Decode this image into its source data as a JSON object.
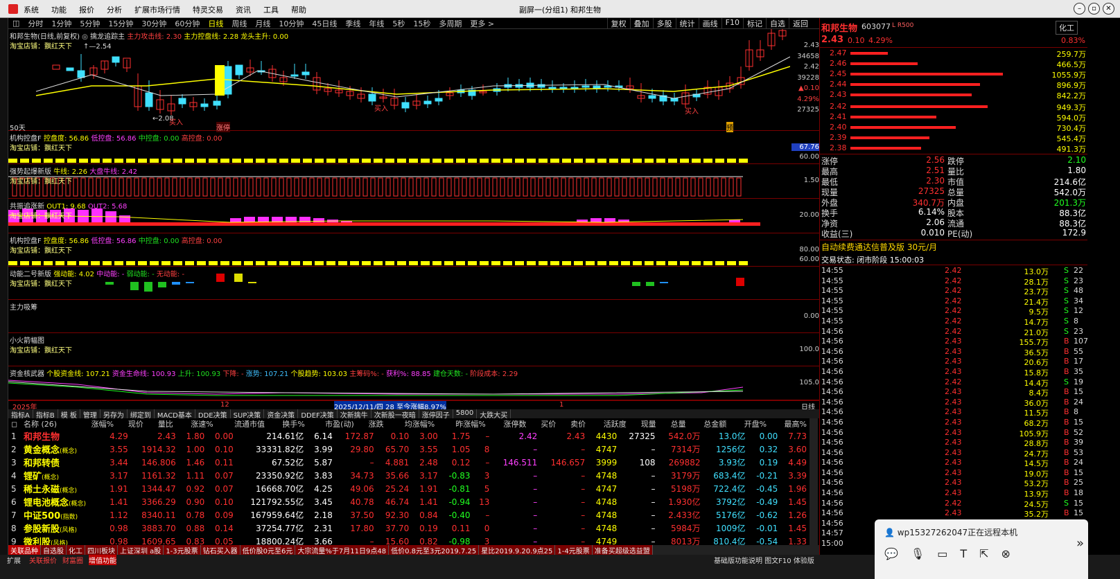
{
  "window": {
    "title": "副屏一(分组1) 和邦生物",
    "menu": [
      "系统",
      "功能",
      "报价",
      "分析",
      "扩展市场行情",
      "特灵交易",
      "资讯",
      "工具",
      "帮助"
    ]
  },
  "toolbar": {
    "periods": [
      "分时",
      "1分钟",
      "5分钟",
      "15分钟",
      "30分钟",
      "60分钟",
      "日线",
      "周线",
      "月线",
      "10分钟",
      "45日线",
      "季线",
      "年线",
      "5秒",
      "15秒",
      "多周期",
      "更多 >"
    ],
    "active": "日线",
    "right": [
      "复权",
      "叠加",
      "多股",
      "统计",
      "画线",
      "F10",
      "标记",
      "自选",
      "返回"
    ]
  },
  "main_chart": {
    "title": "和邦生物(日线,前复权)",
    "indicator": "擒龙追踪主",
    "l1": "主力攻击线: 2.30",
    "l2": "主力控盘线: 2.28",
    "l3": "龙头主升: 0.00",
    "shop": "淘宝店铺：飘红天下",
    "hi_label": "2.54",
    "lo_label": "2.08",
    "buy1": "买入",
    "buy2": "买入",
    "buy3": "买入",
    "zhangting": "涨停",
    "yu": "预",
    "days": "50天",
    "axis": [
      "2.43",
      "34658",
      "2.42",
      "39228",
      "▲0.10",
      "4.29%",
      "27325"
    ]
  },
  "panels": [
    {
      "id": "p1",
      "t": "机构控盘F",
      "v": [
        "控盘度: 56.86",
        "低控盘: 56.86",
        "中控盘: 0.00",
        "高控盘: 0.00"
      ],
      "shop": "淘宝店铺：飘红天下",
      "axis": [
        "67.76",
        "60.00"
      ]
    },
    {
      "id": "p2",
      "t": "强势起爆新版",
      "v": [
        "牛线: 2.26",
        "大盘牛线: 2.42"
      ],
      "shop": "淘宝店铺：飘红天下",
      "axis": [
        "1.50"
      ]
    },
    {
      "id": "p3",
      "t": "共振追涨新",
      "v": [
        "OUT1: 9.68",
        "OUT2: 5.68"
      ],
      "shop": "淘宝店铺：飘红天下",
      "axis": [
        "20.00"
      ]
    },
    {
      "id": "p4",
      "t": "机构控盘F",
      "v": [
        "控盘度: 56.86",
        "低控盘: 56.86",
        "中控盘: 0.00",
        "高控盘: 0.00"
      ],
      "shop": "淘宝店铺：飘红天下",
      "axis": [
        "80.00",
        "60.00"
      ]
    },
    {
      "id": "p5",
      "t": "动能二号新版",
      "v": [
        "强动能: 4.02",
        "中动能: -",
        "弱动能: -",
        "无动能: -"
      ],
      "shop": "淘宝店铺：飘红天下",
      "axis": []
    },
    {
      "id": "p6",
      "t": "主力吸筹",
      "v": [],
      "shop": "",
      "axis": [
        "0.00"
      ]
    },
    {
      "id": "p7",
      "t": "小火箭幅图",
      "v": [],
      "shop": "淘宝店铺：飘红天下",
      "axis": [
        "100.0"
      ]
    },
    {
      "id": "p8",
      "t": "资金核武器",
      "v": [
        "个股资金线: 107.21",
        "资金生命线: 100.93",
        "上升: 100.93",
        "下降: -",
        "涨势: 107.21",
        "个股趋势: 103.03",
        "主筹码%: -",
        "获利%: 88.85",
        "建仓天数: -",
        "阶段成本: 2.29"
      ],
      "shop": "",
      "axis": [
        "105.0"
      ]
    }
  ],
  "xaxis": {
    "y2025": "2025年",
    "m12": "12",
    "m1": "1",
    "range_text": "2025/12/11/四 28 至今涨幅8.97%",
    "period": "日线"
  },
  "tabs_row": [
    "指标A",
    "指标B",
    "模 板",
    "管理",
    "另存为",
    "绑定到",
    "MACD基本",
    "DDE决策",
    "SUP决策",
    "资金决策",
    "DDEF决策",
    "次新擒牛",
    "次新股一夜暗",
    "涨停因子",
    "5800",
    "大跌大买"
  ],
  "quote": {
    "name": "和邦生物",
    "code": "603077",
    "tag": "L R500",
    "industry": "化工",
    "price": "2.43",
    "chg": "0.10",
    "pct": "4.29%",
    "ratio": "0.83%",
    "asks": [
      {
        "p": "2.47",
        "v": "259.7万"
      },
      {
        "p": "2.46",
        "v": "466.5万"
      },
      {
        "p": "2.45",
        "v": "1055.9万"
      },
      {
        "p": "2.44",
        "v": "896.9万"
      },
      {
        "p": "2.43",
        "v": "842.2万"
      }
    ],
    "bids": [
      {
        "p": "2.42",
        "v": "949.3万"
      },
      {
        "p": "2.41",
        "v": "594.0万"
      },
      {
        "p": "2.40",
        "v": "730.4万"
      },
      {
        "p": "2.39",
        "v": "545.4万"
      },
      {
        "p": "2.38",
        "v": "491.3万"
      }
    ],
    "stats": [
      [
        "涨停",
        "2.56",
        "跌停",
        "2.10"
      ],
      [
        "最高",
        "2.51",
        "量比",
        "1.80"
      ],
      [
        "最低",
        "2.30",
        "市值",
        "214.6亿"
      ],
      [
        "现量",
        "27325",
        "总量",
        "542.0万"
      ],
      [
        "外盘",
        "340.7万",
        "内盘",
        "201.3万"
      ],
      [
        "换手",
        "6.14%",
        "股本",
        "88.3亿"
      ],
      [
        "净资",
        "2.06",
        "流通",
        "88.3亿"
      ],
      [
        "收益(三)",
        "0.010",
        "PE(动)",
        "172.9"
      ]
    ],
    "ad": "自动续费通达信普及版  30元/月",
    "trade_state": "交易状态: 闭市阶段 15:00:03"
  },
  "ticks": [
    [
      "14:55",
      "2.42",
      "13.0万",
      "S",
      "22"
    ],
    [
      "14:55",
      "2.42",
      "28.1万",
      "S",
      "23"
    ],
    [
      "14:55",
      "2.42",
      "23.7万",
      "S",
      "48"
    ],
    [
      "14:55",
      "2.42",
      "21.4万",
      "S",
      "34"
    ],
    [
      "14:55",
      "2.42",
      "9.5万",
      "S",
      "12"
    ],
    [
      "14:55",
      "2.42",
      "14.7万",
      "S",
      "8"
    ],
    [
      "14:56",
      "2.42",
      "21.0万",
      "S",
      "23"
    ],
    [
      "14:56",
      "2.43",
      "155.7万",
      "B",
      "107"
    ],
    [
      "14:56",
      "2.43",
      "36.5万",
      "B",
      "55"
    ],
    [
      "14:56",
      "2.43",
      "20.6万",
      "B",
      "17"
    ],
    [
      "14:56",
      "2.43",
      "15.8万",
      "B",
      "35"
    ],
    [
      "14:56",
      "2.42",
      "14.4万",
      "S",
      "19"
    ],
    [
      "14:56",
      "2.43",
      "8.4万",
      "B",
      "15"
    ],
    [
      "14:56",
      "2.43",
      "36.0万",
      "B",
      "24"
    ],
    [
      "14:56",
      "2.43",
      "11.5万",
      "B",
      "8"
    ],
    [
      "14:56",
      "2.43",
      "68.2万",
      "B",
      "15"
    ],
    [
      "14:56",
      "2.43",
      "105.9万",
      "B",
      "52"
    ],
    [
      "14:56",
      "2.43",
      "28.8万",
      "B",
      "39"
    ],
    [
      "14:56",
      "2.43",
      "24.7万",
      "B",
      "53"
    ],
    [
      "14:56",
      "2.43",
      "14.5万",
      "B",
      "24"
    ],
    [
      "14:56",
      "2.43",
      "19.0万",
      "B",
      "15"
    ],
    [
      "14:56",
      "2.43",
      "53.2万",
      "B",
      "25"
    ],
    [
      "14:56",
      "2.43",
      "13.9万",
      "B",
      "18"
    ],
    [
      "14:56",
      "2.42",
      "24.5万",
      "S",
      "15"
    ],
    [
      "14:56",
      "2.43",
      "35.2万",
      "B",
      "15"
    ],
    [
      "14:56",
      "",
      "",
      " ",
      ""
    ],
    [
      "14:57",
      "",
      "",
      " ",
      ""
    ],
    [
      "15:00",
      "",
      "",
      " ",
      ""
    ]
  ],
  "table": {
    "header": [
      "名称 (26)",
      "涨幅%",
      "现价",
      "量比",
      "涨速%",
      "流通市值",
      "换手%",
      "市盈(动)",
      "涨跌",
      "均涨幅%",
      "昨涨幅%",
      "涨停数",
      "买价",
      "卖价",
      "活跃度",
      "现量",
      "总量",
      "总金额",
      "开盘%",
      "最高%"
    ],
    "rows": [
      [
        "1",
        "和邦生物",
        "",
        "4.29",
        "2.43",
        "1.80",
        "0.00",
        "214.61亿",
        "6.14",
        "172.87",
        "0.10",
        "3.00",
        "1.75",
        "–",
        "2.42",
        "2.43",
        "4430",
        "27325",
        "542.0万",
        "13.0亿",
        "0.00",
        "7.73"
      ],
      [
        "2",
        "黄金概念",
        "(概念)",
        "3.55",
        "1914.32",
        "1.00",
        "0.10",
        "33331.82亿",
        "3.99",
        "29.80",
        "65.70",
        "3.55",
        "1.05",
        "8",
        "–",
        "–",
        "4747",
        "–",
        "7314万",
        "1256亿",
        "0.32",
        "3.60"
      ],
      [
        "3",
        "和邦转债",
        "",
        "3.44",
        "146.806",
        "1.46",
        "0.11",
        "67.52亿",
        "5.87",
        "–",
        "4.881",
        "2.48",
        "0.12",
        "–",
        "146.511",
        "146.657",
        "3999",
        "108",
        "269882",
        "3.93亿",
        "0.19",
        "4.49"
      ],
      [
        "4",
        "锂矿",
        "(概念)",
        "3.17",
        "1161.32",
        "1.11",
        "0.07",
        "23350.92亿",
        "3.83",
        "34.73",
        "35.66",
        "3.17",
        "-0.83",
        "3",
        "–",
        "–",
        "4748",
        "–",
        "3179万",
        "683.4亿",
        "-0.21",
        "3.39"
      ],
      [
        "5",
        "稀土永磁",
        "(概念)",
        "1.91",
        "1344.47",
        "0.92",
        "0.07",
        "16668.70亿",
        "4.25",
        "49.06",
        "25.24",
        "1.91",
        "-0.81",
        "5",
        "–",
        "–",
        "4747",
        "–",
        "5198万",
        "722.4亿",
        "-0.45",
        "1.96"
      ],
      [
        "6",
        "锂电池概念",
        "(概念)",
        "1.41",
        "3366.29",
        "0.90",
        "0.10",
        "121792.55亿",
        "3.45",
        "40.78",
        "46.74",
        "1.41",
        "-0.94",
        "13",
        "–",
        "–",
        "4748",
        "–",
        "1.930亿",
        "3792亿",
        "-0.49",
        "1.45"
      ],
      [
        "7",
        "中证500",
        "(指数)",
        "1.12",
        "8340.11",
        "0.78",
        "0.09",
        "167959.64亿",
        "2.18",
        "37.50",
        "92.30",
        "0.84",
        "-0.40",
        "–",
        "–",
        "–",
        "4748",
        "–",
        "2.433亿",
        "5176亿",
        "-0.62",
        "1.26"
      ],
      [
        "8",
        "参股新股",
        "(风格)",
        "0.98",
        "3883.70",
        "0.88",
        "0.14",
        "37254.77亿",
        "2.31",
        "17.80",
        "37.70",
        "0.19",
        "0.11",
        "0",
        "–",
        "–",
        "4748",
        "–",
        "5984万",
        "1009亿",
        "-0.01",
        "1.45"
      ],
      [
        "9",
        "微利股",
        "(风格)",
        "0.98",
        "1609.65",
        "0.83",
        "0.05",
        "18800.24亿",
        "3.66",
        "–",
        "15.60",
        "0.82",
        "-0.98",
        "3",
        "–",
        "–",
        "4749",
        "–",
        "8013万",
        "810.4亿",
        "-0.54",
        "1.33"
      ]
    ]
  },
  "bottom_tabs": [
    "关联品种",
    "自选股",
    "化工",
    "四川板块",
    "上证深圳 a股",
    "1-3元股票",
    "钻石买入器",
    "低价股0元至6元",
    "大宗流量%于7月11日9点48",
    "低价0.8元至3元2019.7.25",
    "星比2019.9.20.9点25",
    "1-4元股票",
    "准备买超级选益盟"
  ],
  "status": {
    "s1": "扩展",
    "s2": "关联报价",
    "s3": "财富圈",
    "s4": "增值功能",
    "right": "基础版功能说明 图文F10 体验版 "
  },
  "remote": {
    "text": "wp15327262047正在远程本机"
  }
}
